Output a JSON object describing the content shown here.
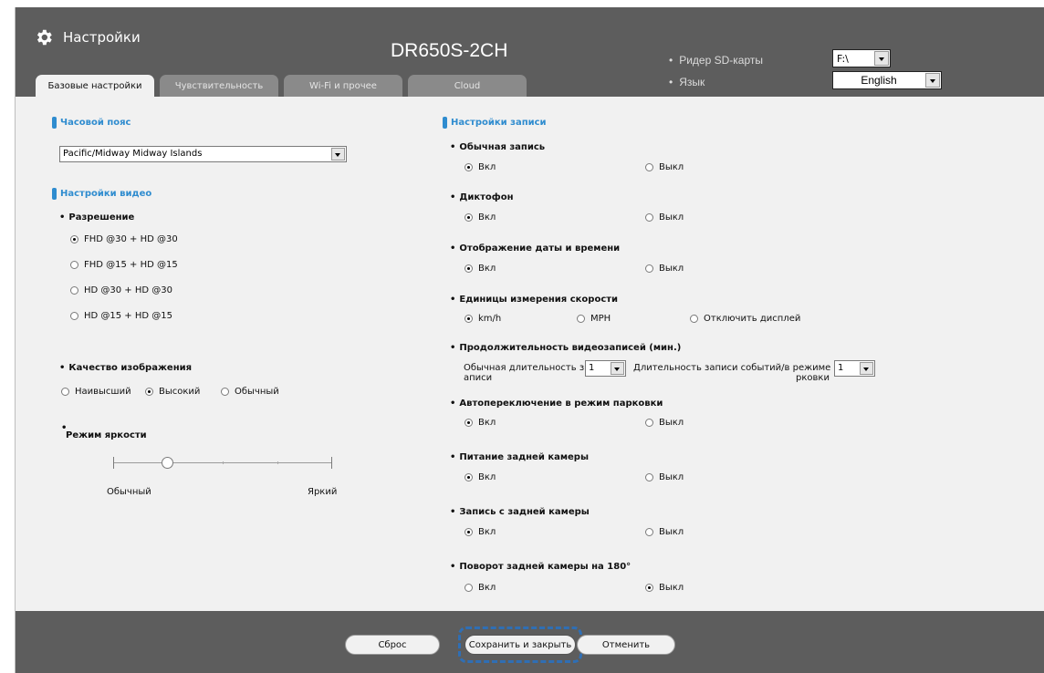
{
  "header": {
    "app_title": "Настройки",
    "model": "DR650S-2CH",
    "sd_reader_label": "Ридер SD-карты",
    "sd_reader_value": "F:\\",
    "language_label": "Язык",
    "language_value": "English"
  },
  "tabs": [
    {
      "label": "Базовые настройки",
      "active": true
    },
    {
      "label": "Чувствительность",
      "active": false
    },
    {
      "label": "Wi-Fi и прочее",
      "active": false
    },
    {
      "label": "Cloud",
      "active": false
    }
  ],
  "left": {
    "timezone_title": "Часовой пояс",
    "timezone_value": "Pacific/Midway Midway Islands",
    "video_title": "Настройки видео",
    "resolution_label": "Разрешение",
    "resolution_options": [
      "FHD @30 + HD @30",
      "FHD @15 + HD @15",
      "HD @30 + HD @30",
      "HD @15 + HD @15"
    ],
    "resolution_selected": 0,
    "quality_label": "Качество изображения",
    "quality_options": [
      "Наивысший",
      "Высокий",
      "Обычный"
    ],
    "quality_selected": 1,
    "brightness_label": "Режим яркости",
    "brightness_min_label": "Обычный",
    "brightness_max_label": "Яркий",
    "brightness_level": 1,
    "brightness_steps": 5
  },
  "right": {
    "record_title": "Настройки записи",
    "on": "Вкл",
    "off": "Выкл",
    "normal_record_label": "Обычная запись",
    "normal_record_on": true,
    "voice_label": "Диктофон",
    "voice_on": true,
    "datetime_label": "Отображение даты и времени",
    "datetime_on": true,
    "speed_label": "Единицы измерения скорости",
    "speed_options": [
      "km/h",
      "MPH",
      "Отключить дисплей"
    ],
    "speed_selected": 0,
    "duration_label": "Продолжительность видеозаписей (мин.)",
    "normal_duration_label_1": "Обычная длительность з",
    "normal_duration_label_2": "аписи",
    "normal_duration_value": "1",
    "event_duration_label_1": "Длительность записи событий/в режиме па",
    "event_duration_label_2": "рковки",
    "event_duration_value": "1",
    "parking_label": "Автопереключение в режим парковки",
    "parking_on": true,
    "rear_power_label": "Питание задней камеры",
    "rear_power_on": true,
    "rear_record_label": "Запись с задней камеры",
    "rear_record_on": true,
    "rear_rotate_label": "Поворот задней камеры на 180°",
    "rear_rotate_on": false
  },
  "footer": {
    "reset_label": "Сброс",
    "save_label": "Сохранить и закрыть",
    "cancel_label": "Отменить"
  },
  "colors": {
    "accent": "#2f8ccf",
    "header_bg": "#5d5d5d",
    "panel_bg": "#f1f1f1",
    "highlight": "#2f6fb5"
  }
}
